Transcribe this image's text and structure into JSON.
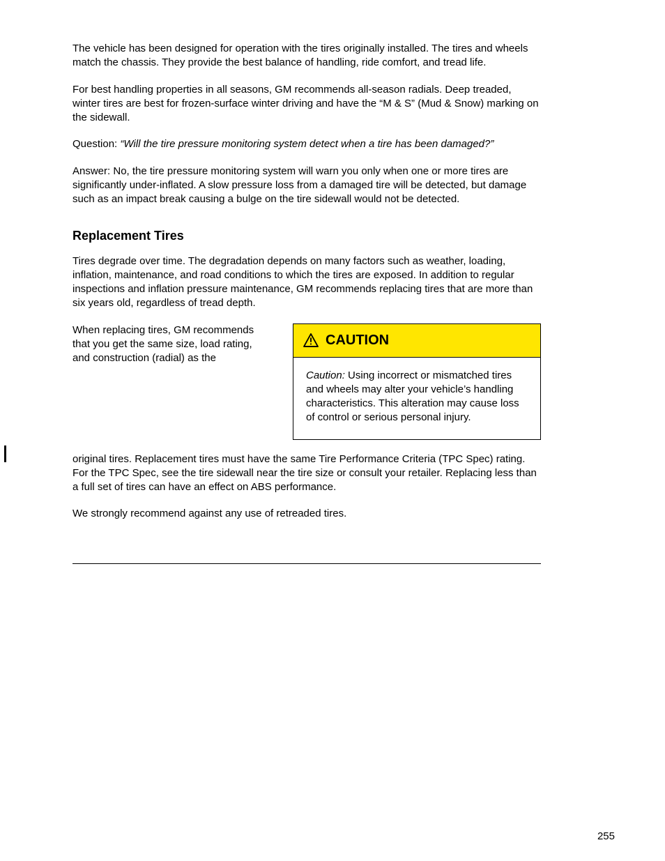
{
  "p1": "The vehicle has been designed for operation with the tires originally installed. The tires and wheels match the chassis. They provide the best balance of handling, ride comfort, and tread life.",
  "p2": "For best handling properties in all seasons, GM recommends all-season radials. Deep treaded, winter tires are best for frozen-surface winter driving and have the “M & S” (Mud & Snow) marking on the sidewall.",
  "p3_lead": "Question:",
  "p3_q": "“Will the tire pressure monitoring system detect when a tire has been damaged?”",
  "p4_a": "Answer:",
  "p4_b": "No, the tire pressure monitoring system will warn you only when one or more tires are significantly under-inflated. A slow pressure loss from a damaged tire will be detected, but damage such as an impact break causing a bulge on the tire sidewall would not be detected.",
  "h1": "Replacement Tires",
  "p5": "Tires degrade over time. The degradation depends on many factors such as weather, loading, inflation, maintenance, and road conditions to which the tires are exposed. In addition to regular inspections and inflation pressure maintenance, GM recommends replacing tires that are more than six years old, regardless of tread depth.",
  "p6_left": "When replacing tires, GM recommends that you get the same size, load rating, and construction (radial) as the",
  "caution_label": "CAUTION",
  "caution_body_lead": "Caution:",
  "caution_body_text": " Using incorrect or mismatched tires and wheels may alter your vehicle’s handling characteristics. This alteration may cause loss of control or serious personal injury.",
  "p7": "original tires. Replacement tires must have the same Tire Performance Criteria (TPC Spec) rating. For the TPC Spec, see the tire sidewall near the tire size or consult your retailer. Replacing less than a full set of tires can have an effect on ABS performance.",
  "p8": "We strongly recommend against any use of retreaded tires.",
  "page_number": "255"
}
